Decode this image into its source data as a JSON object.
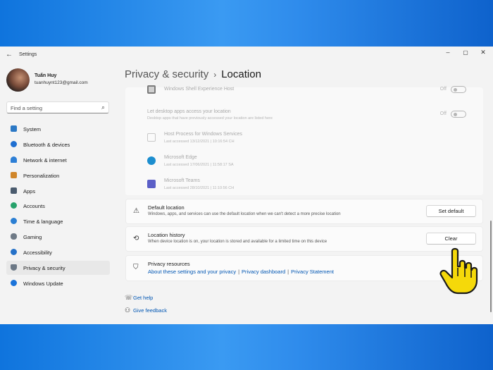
{
  "window": {
    "title": "Settings",
    "back_glyph": "←",
    "minimize_glyph": "–",
    "maximize_glyph": "▢",
    "close_glyph": "✕"
  },
  "profile": {
    "name": "Tuấn Huy",
    "email": "tuanhuynt123@gmail.com"
  },
  "search": {
    "placeholder": "Find a setting",
    "icon": "⌕"
  },
  "sidebar": {
    "items": [
      {
        "label": "System",
        "icon": "system-icon",
        "color": "#2b78c5"
      },
      {
        "label": "Bluetooth & devices",
        "icon": "bluetooth-icon",
        "color": "#1f6fd1"
      },
      {
        "label": "Network & internet",
        "icon": "network-icon",
        "color": "#2d7fd6"
      },
      {
        "label": "Personalization",
        "icon": "brush-icon",
        "color": "#d0862a"
      },
      {
        "label": "Apps",
        "icon": "apps-icon",
        "color": "#4a5b6e"
      },
      {
        "label": "Accounts",
        "icon": "accounts-icon",
        "color": "#26a26b"
      },
      {
        "label": "Time & language",
        "icon": "globe-icon",
        "color": "#2b7fd3"
      },
      {
        "label": "Gaming",
        "icon": "gaming-icon",
        "color": "#6e7a86"
      },
      {
        "label": "Accessibility",
        "icon": "accessibility-icon",
        "color": "#2571c8"
      },
      {
        "label": "Privacy & security",
        "icon": "shield-icon",
        "color": "#6b7785"
      },
      {
        "label": "Windows Update",
        "icon": "update-icon",
        "color": "#1a73d9"
      }
    ]
  },
  "breadcrumb": {
    "parent": "Privacy & security",
    "separator": "›",
    "current": "Location"
  },
  "faded": {
    "shell_host": {
      "name": "Windows Shell Experience Host",
      "toggle_label": "Off"
    },
    "desktop_apps": {
      "title": "Let desktop apps access your location",
      "desc": "Desktop apps that have previously accessed your location are listed here",
      "toggle_label": "Off"
    },
    "apps": [
      {
        "name": "Host Process for Windows Services",
        "sub": "Last accessed 13/12/2021 | 10:16:54 CH",
        "icon": "file-icon",
        "color": "#e6e6e6"
      },
      {
        "name": "Microsoft Edge",
        "sub": "Last accessed 17/06/2021 | 11:58:17 SA",
        "icon": "edge-icon",
        "color": "#1c8ecf"
      },
      {
        "name": "Microsoft Teams",
        "sub": "Last accessed 28/10/2021 | 11:10:56 CH",
        "icon": "teams-icon",
        "color": "#5b5fc7"
      }
    ]
  },
  "cards": {
    "default_location": {
      "title": "Default location",
      "desc": "Windows, apps, and services can use the default location when we can't detect a more precise location",
      "button": "Set default"
    },
    "location_history": {
      "title": "Location history",
      "desc": "When device location is on, your location is stored and available for a limited time on this device",
      "button": "Clear"
    },
    "privacy_resources": {
      "title": "Privacy resources",
      "link1": "About these settings and your privacy",
      "link2": "Privacy dashboard",
      "link3": "Privacy Statement",
      "separator": "|"
    }
  },
  "help": {
    "get_help": "Get help",
    "give_feedback": "Give feedback"
  },
  "colors": {
    "accent": "#0056b3",
    "cursor": "#f5d90a"
  }
}
